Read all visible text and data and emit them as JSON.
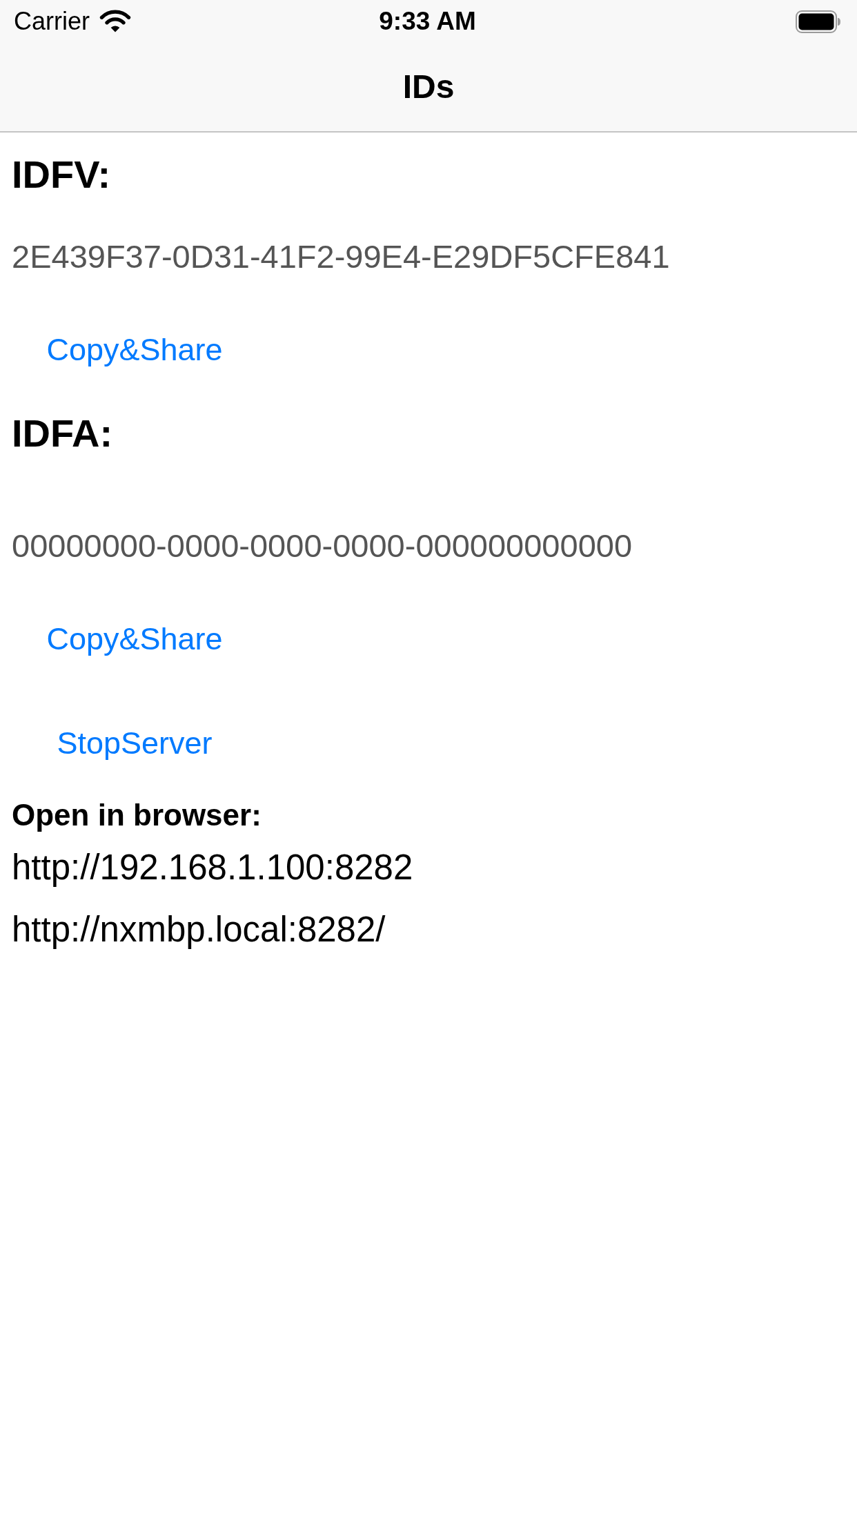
{
  "status_bar": {
    "carrier": "Carrier",
    "time": "9:33 AM"
  },
  "navigation_bar": {
    "title": "IDs"
  },
  "id_sections": [
    {
      "heading": "IDFV:",
      "value": "2E439F37-0D31-41F2-99E4-E29DF5CFE841",
      "button": "Copy&Share"
    },
    {
      "heading": "IDFA:",
      "value": "00000000-0000-0000-0000-000000000000",
      "button": "Copy&Share"
    }
  ],
  "server_button": "StopServer",
  "browser_section": {
    "label": "Open in browser:",
    "urls": [
      "http://192.168.1.100:8282",
      "http://nxmbp.local:8282/"
    ]
  }
}
